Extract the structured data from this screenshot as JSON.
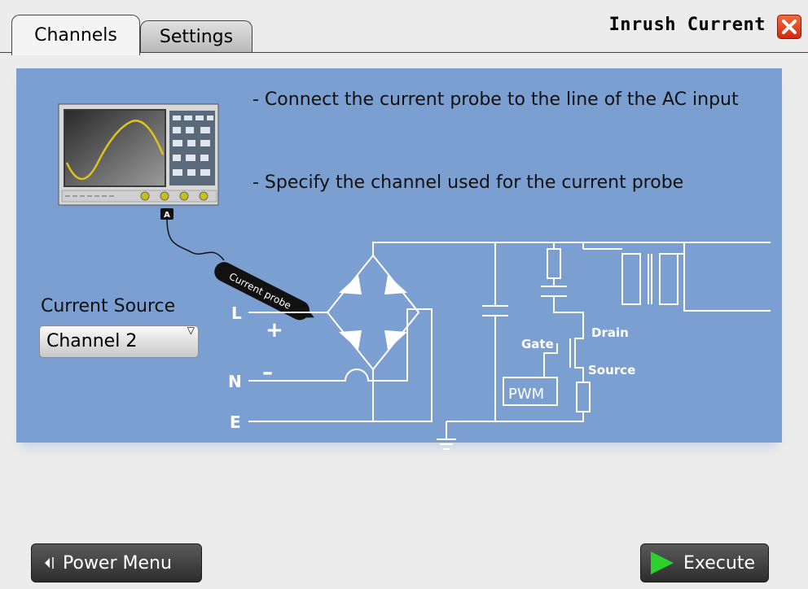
{
  "tabs": [
    {
      "label": "Channels"
    },
    {
      "label": "Settings"
    }
  ],
  "dialog": {
    "title": "Inrush Current"
  },
  "instructions": [
    "- Connect the current probe to the line of the AC input",
    "- Specify the channel used for the current probe"
  ],
  "diagram": {
    "probe_label": "Current probe",
    "probe_tag": "A",
    "line_labels": [
      "L",
      "N",
      "E"
    ],
    "polarity": [
      "+",
      "–"
    ],
    "gate": "Gate",
    "drain": "Drain",
    "source": "Source",
    "pwm": "PWM"
  },
  "current_source": {
    "label": "Current Source",
    "value": "Channel 2"
  },
  "buttons": {
    "power_menu": "Power Menu",
    "execute": "Execute"
  },
  "colors": {
    "panel": "#7c9fd1",
    "execute_icon": "#2ed02e",
    "close": "#e0431d"
  }
}
